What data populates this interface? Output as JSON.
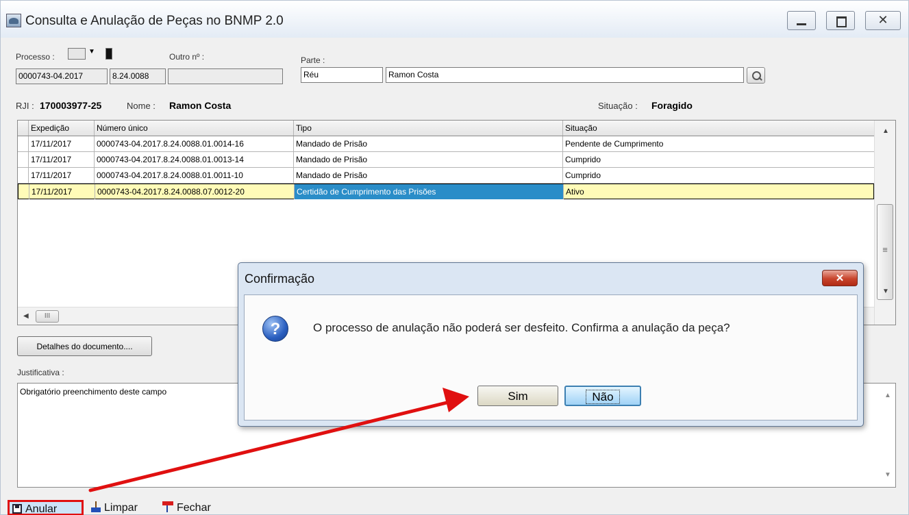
{
  "window": {
    "title": "Consulta e Anulação de Peças no BNMP 2.0",
    "close_glyph": "✕"
  },
  "form": {
    "processo_label": "Processo :",
    "outro_label": "Outro nº :",
    "parte_label": "Parte :",
    "processo_number": "0000743-04.2017",
    "processo_suffix": "8.24.0088",
    "outro_value": "",
    "parte_tipo": "Réu",
    "parte_nome": "Ramon Costa",
    "rji_label": "RJI :",
    "rji_value": "170003977-25",
    "nome_label": "Nome :",
    "nome_value": "Ramon Costa",
    "situacao_label": "Situação :",
    "situacao_value": "Foragido"
  },
  "grid": {
    "columns": [
      "Expedição",
      "Número único",
      "Tipo",
      "Situação"
    ],
    "rows": [
      [
        "17/11/2017",
        "0000743-04.2017.8.24.0088.01.0014-16",
        "Mandado de Prisão",
        "Pendente de Cumprimento"
      ],
      [
        "17/11/2017",
        "0000743-04.2017.8.24.0088.01.0013-14",
        "Mandado de Prisão",
        "Cumprido"
      ],
      [
        "17/11/2017",
        "0000743-04.2017.8.24.0088.01.0011-10",
        "Mandado de Prisão",
        "Cumprido"
      ],
      [
        "17/11/2017",
        "0000743-04.2017.8.24.0088.07.0012-20",
        "Certidão de Cumprimento das Prisões",
        "Ativo"
      ]
    ],
    "scroll_thumb_glyph": "≡",
    "hscroll_thumb_glyph": "III"
  },
  "details_button": "Detalhes do documento....",
  "justificativa_label": "Justificativa :",
  "justificativa_text": "Obrigatório preenchimento deste campo",
  "toolbar": {
    "anular": "Anular",
    "limpar": "Limpar",
    "fechar": "Fechar"
  },
  "dialog": {
    "title": "Confirmação",
    "message": "O processo de anulação não poderá ser desfeito. Confirma a anulação da peça?",
    "question_glyph": "?",
    "close_glyph": "✕",
    "yes": "Sim",
    "no": "Não"
  },
  "colors": {
    "selection_row": "#fffbb8",
    "selection_cell": "#2a8dc8",
    "annotation_arrow": "#e01010"
  }
}
